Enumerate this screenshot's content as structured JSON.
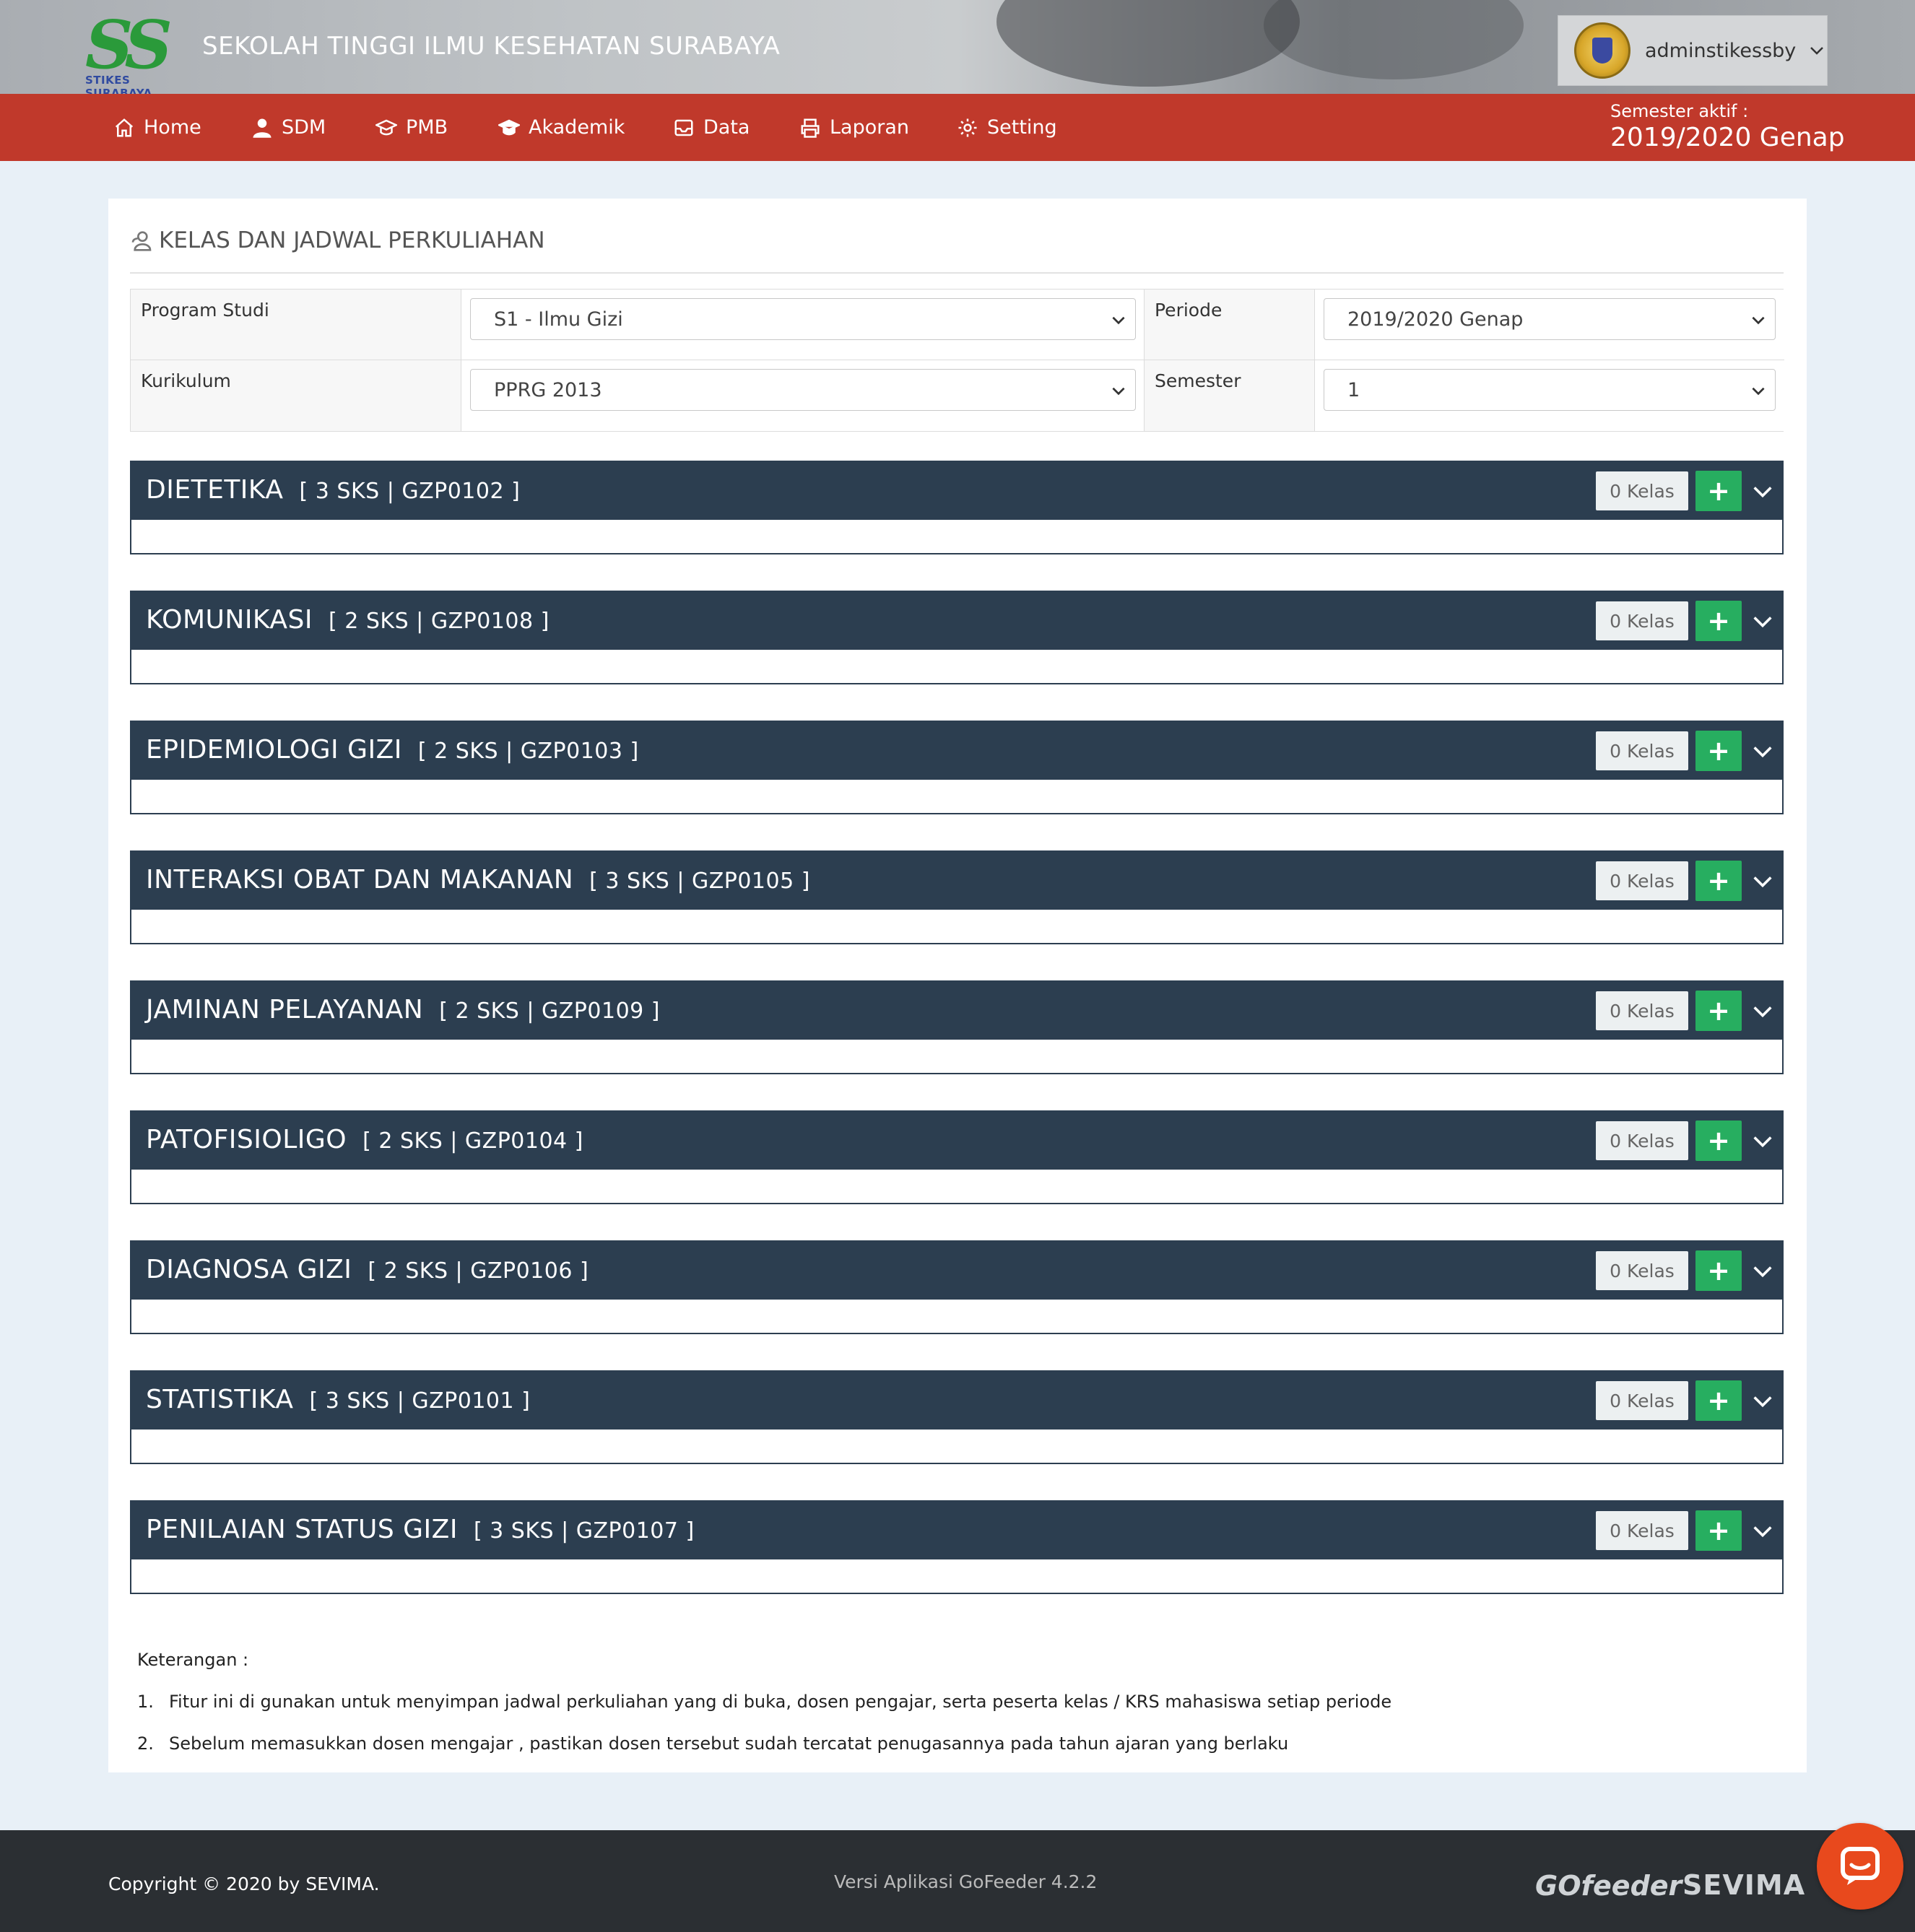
{
  "header": {
    "logo_text": "SS",
    "logo_subtext": "STIKES SURABAYA",
    "school_name": "SEKOLAH TINGGI ILMU KESEHATAN SURABAYA",
    "username": "adminstikessby"
  },
  "nav": {
    "items": [
      {
        "label": "Home",
        "icon": "home-icon"
      },
      {
        "label": "SDM",
        "icon": "user-icon"
      },
      {
        "label": "PMB",
        "icon": "graduation-cap-icon"
      },
      {
        "label": "Akademik",
        "icon": "graduation-cap-icon"
      },
      {
        "label": "Data",
        "icon": "inbox-icon"
      },
      {
        "label": "Laporan",
        "icon": "printer-icon"
      },
      {
        "label": "Setting",
        "icon": "gear-icon"
      }
    ],
    "semester_label": "Semester aktif :",
    "semester_value": "2019/2020 Genap"
  },
  "page": {
    "title": "KELAS DAN JADWAL PERKULIAHAN",
    "filters": {
      "program_studi_label": "Program Studi",
      "program_studi_value": "S1 - Ilmu Gizi",
      "periode_label": "Periode",
      "periode_value": "2019/2020 Genap",
      "kurikulum_label": "Kurikulum",
      "kurikulum_value": "PPRG 2013",
      "semester_label": "Semester",
      "semester_value": "1"
    },
    "courses": [
      {
        "name": "DIETETIKA",
        "info": "[ 3 SKS | GZP0102 ]",
        "kelas": "0 Kelas"
      },
      {
        "name": "KOMUNIKASI",
        "info": "[ 2 SKS | GZP0108 ]",
        "kelas": "0 Kelas"
      },
      {
        "name": "EPIDEMIOLOGI GIZI",
        "info": "[ 2 SKS | GZP0103 ]",
        "kelas": "0 Kelas"
      },
      {
        "name": "INTERAKSI OBAT DAN MAKANAN",
        "info": "[ 3 SKS | GZP0105 ]",
        "kelas": "0 Kelas"
      },
      {
        "name": "JAMINAN PELAYANAN",
        "info": "[ 2 SKS | GZP0109 ]",
        "kelas": "0 Kelas"
      },
      {
        "name": "PATOFISIOLIGO",
        "info": "[ 2 SKS | GZP0104 ]",
        "kelas": "0 Kelas"
      },
      {
        "name": "DIAGNOSA GIZI",
        "info": "[ 2 SKS | GZP0106 ]",
        "kelas": "0 Kelas"
      },
      {
        "name": "STATISTIKA",
        "info": "[ 3 SKS | GZP0101 ]",
        "kelas": "0 Kelas"
      },
      {
        "name": "PENILAIAN STATUS GIZI",
        "info": "[ 3 SKS | GZP0107 ]",
        "kelas": "0 Kelas"
      }
    ],
    "add_label": "+",
    "notes_title": "Keterangan :",
    "notes": [
      {
        "num": "1.",
        "text": "Fitur ini di gunakan untuk menyimpan jadwal perkuliahan yang di buka, dosen pengajar, serta peserta kelas / KRS mahasiswa setiap periode"
      },
      {
        "num": "2.",
        "text": "Sebelum memasukkan dosen mengajar , pastikan dosen tersebut sudah tercatat penugasannya pada tahun ajaran yang berlaku"
      }
    ]
  },
  "footer": {
    "copyright": "Copyright © 2020 by SEVIMA.",
    "version": "Versi Aplikasi GoFeeder 4.2.2",
    "brand1": "GOfeeder",
    "brand2": "SEVIMA"
  },
  "colors": {
    "navbar": "#c0392b",
    "course_header": "#2c3e50",
    "add_button": "#27ae60",
    "chat_button": "#e8491d"
  }
}
